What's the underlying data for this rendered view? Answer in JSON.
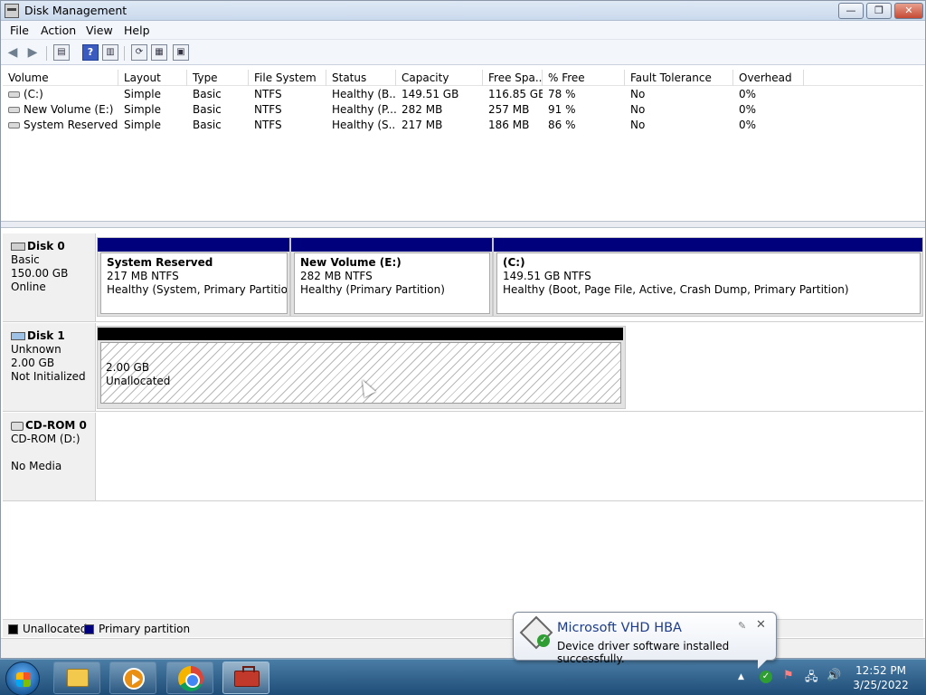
{
  "window": {
    "title": "Disk Management",
    "controls": {
      "minimize": "—",
      "maximize": "❐",
      "close": "✕"
    }
  },
  "menu": [
    "File",
    "Action",
    "View",
    "Help"
  ],
  "toolbar": {
    "icons": [
      "back-arrow-icon",
      "forward-arrow-icon",
      "properties-icon",
      "help-icon",
      "details-pane-icon",
      "refresh-icon",
      "rescan-icon",
      "settings-icon"
    ],
    "help_label": "?"
  },
  "volumes": {
    "columns": [
      "Volume",
      "Layout",
      "Type",
      "File System",
      "Status",
      "Capacity",
      "Free Spa...",
      "% Free",
      "Fault Tolerance",
      "Overhead"
    ],
    "rows": [
      [
        "(C:)",
        "Simple",
        "Basic",
        "NTFS",
        "Healthy (B...",
        "149.51 GB",
        "116.85 GB",
        "78 %",
        "No",
        "0%"
      ],
      [
        "New Volume (E:)",
        "Simple",
        "Basic",
        "NTFS",
        "Healthy (P...",
        "282 MB",
        "257 MB",
        "91 %",
        "No",
        "0%"
      ],
      [
        "System Reserved",
        "Simple",
        "Basic",
        "NTFS",
        "Healthy (S...",
        "217 MB",
        "186 MB",
        "86 %",
        "No",
        "0%"
      ]
    ]
  },
  "disks": [
    {
      "name": "Disk 0",
      "type": "Basic",
      "size": "150.00 GB",
      "status": "Online",
      "partitions": [
        {
          "name": "System Reserved",
          "size": "217 MB NTFS",
          "status": "Healthy (System, Primary Partition)"
        },
        {
          "name": "New Volume  (E:)",
          "size": "282 MB NTFS",
          "status": "Healthy (Primary Partition)"
        },
        {
          "name": " (C:)",
          "size": "149.51 GB NTFS",
          "status": "Healthy (Boot, Page File, Active, Crash Dump, Primary Partition)"
        }
      ]
    },
    {
      "name": "Disk 1",
      "type": "Unknown",
      "size": "2.00 GB",
      "status": "Not Initialized",
      "unallocated": {
        "size": "2.00 GB",
        "label": "Unallocated"
      }
    },
    {
      "name": "CD-ROM 0",
      "type": "CD-ROM (D:)",
      "status": "No Media"
    }
  ],
  "legend": {
    "items": [
      {
        "label": "Unallocated",
        "color": "#000000"
      },
      {
        "label": "Primary partition",
        "color": "#00007d"
      }
    ]
  },
  "notification": {
    "title": "Microsoft VHD HBA",
    "message": "Device driver software installed successfully.",
    "check": "✓",
    "pin": "✎",
    "close": "✕"
  },
  "taskbar": {
    "apps": [
      "windows-explorer",
      "windows-media-player",
      "google-chrome",
      "toolbox"
    ],
    "tray": {
      "arrow": "▲",
      "flag": "⚑",
      "network": "🖧",
      "volume": "🔊"
    },
    "time": "12:52 PM",
    "date": "3/25/2022"
  }
}
